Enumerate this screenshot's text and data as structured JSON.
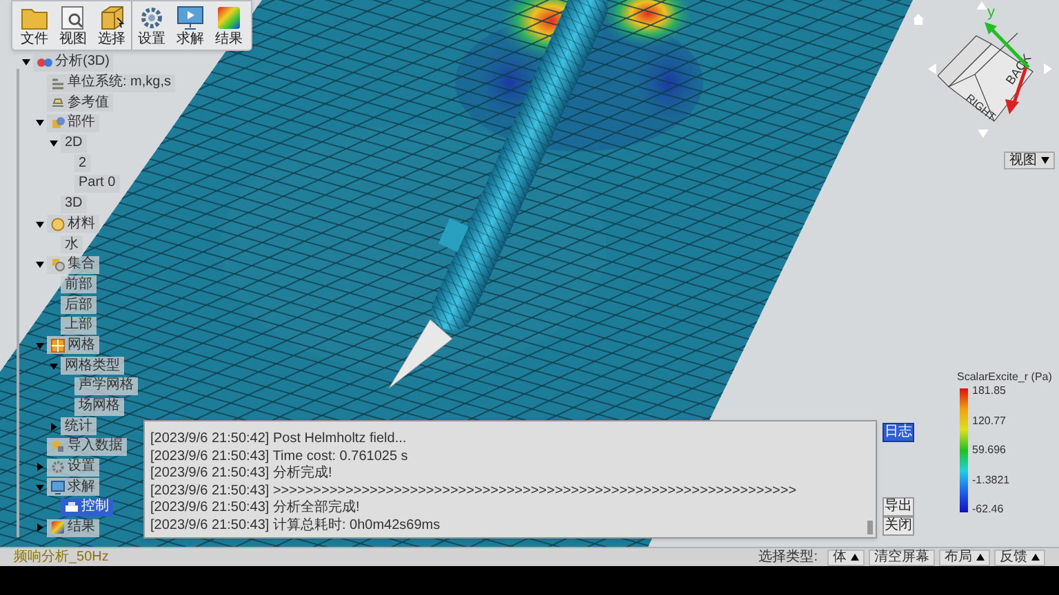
{
  "toolbar": {
    "groups": [
      [
        {
          "label": "文件",
          "kind": "folder"
        },
        {
          "label": "视图",
          "kind": "view"
        },
        {
          "label": "选择",
          "kind": "select"
        }
      ],
      [
        {
          "label": "设置",
          "kind": "settings"
        },
        {
          "label": "求解",
          "kind": "solve"
        },
        {
          "label": "结果",
          "kind": "result"
        }
      ]
    ]
  },
  "tree": [
    {
      "label": "分析(3D)",
      "kind": "analysis",
      "selected": false,
      "expanded": true,
      "children": [
        {
          "label": "单位系统: m,kg,s",
          "kind": "units",
          "selected": false
        },
        {
          "label": "参考值",
          "kind": "reference",
          "selected": false
        },
        {
          "label": "部件",
          "kind": "parts",
          "selected": false,
          "expanded": true,
          "children": [
            {
              "label": "2D",
              "selected": false,
              "expanded": true,
              "children": [
                {
                  "label": "2",
                  "selected": false
                },
                {
                  "label": "Part 0",
                  "selected": false
                }
              ]
            },
            {
              "label": "3D",
              "selected": false
            }
          ]
        },
        {
          "label": "材料",
          "kind": "material",
          "selected": false,
          "expanded": true,
          "children": [
            {
              "label": "水",
              "selected": false
            }
          ]
        },
        {
          "label": "集合",
          "kind": "set",
          "selected": false,
          "expanded": true,
          "children": [
            {
              "label": "前部",
              "selected": false
            },
            {
              "label": "后部",
              "selected": false
            },
            {
              "label": "上部",
              "selected": false
            }
          ]
        },
        {
          "label": "网格",
          "kind": "mesh",
          "selected": false,
          "expanded": true,
          "children": [
            {
              "label": "网格类型",
              "selected": false,
              "expanded": true,
              "children": [
                {
                  "label": "声学网格",
                  "selected": false
                },
                {
                  "label": "场网格",
                  "selected": false
                }
              ]
            },
            {
              "label": "统计",
              "selected": false,
              "expanded": false
            }
          ]
        },
        {
          "label": "导入数据",
          "kind": "import",
          "selected": false
        },
        {
          "label": "设置",
          "kind": "settings",
          "selected": false,
          "expanded": false
        },
        {
          "label": "求解",
          "kind": "solve",
          "selected": false,
          "expanded": true,
          "children": [
            {
              "label": "控制",
              "kind": "control",
              "selected": true
            }
          ]
        },
        {
          "label": "结果",
          "kind": "result",
          "selected": false,
          "expanded": false
        }
      ]
    }
  ],
  "log": {
    "lines": [
      "[2023/9/6 21:50:42] Post Helmholtz field...",
      "[2023/9/6 21:50:43] Time cost: 0.761025 s",
      "[2023/9/6 21:50:43] 分析完成!",
      "[2023/9/6 21:50:43] >>>>>>>>>>>>>>>>>>>>>>>>>>>>>>>>>>>>>>>>>>>>>>>>>>>>>>>>>>>>>>>>>",
      "[2023/9/6 21:50:43] 分析全部完成!",
      "[2023/9/6 21:50:43] 计算总耗时:  0h0m42s69ms"
    ],
    "buttons": [
      {
        "label": "日志",
        "selected": true
      },
      {
        "label": "导出",
        "selected": false
      },
      {
        "label": "关闭",
        "selected": false
      }
    ]
  },
  "legend": {
    "title": "ScalarExcite_r (Pa)",
    "ticks": [
      "181.85",
      "120.77",
      "59.696",
      "-1.3821",
      "-62.46"
    ]
  },
  "view_cube": {
    "faces": [
      "BACK",
      "RIGHT"
    ],
    "axis_label": "y",
    "view_menu": "视图"
  },
  "status_bar": {
    "analysis_name": "频响分析_50Hz",
    "select_type_label": "选择类型:",
    "controls": [
      {
        "label": "体",
        "kind": "dropdown"
      },
      {
        "label": "清空屏幕",
        "kind": "button"
      },
      {
        "label": "布局",
        "kind": "dropdown"
      },
      {
        "label": "反馈",
        "kind": "dropdown"
      }
    ]
  }
}
